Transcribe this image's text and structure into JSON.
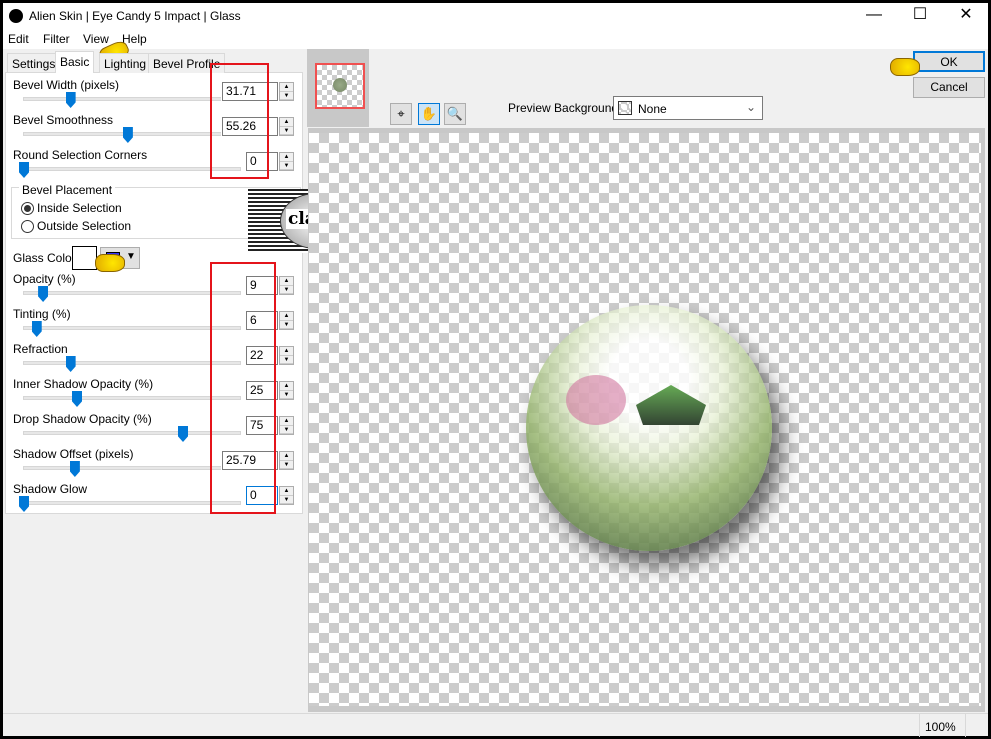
{
  "window": {
    "title": "Alien Skin | Eye Candy 5 Impact | Glass",
    "minimize": "—",
    "maximize": "☐",
    "close": "✕"
  },
  "menu": [
    "Edit",
    "Filter",
    "View",
    "Help"
  ],
  "tabs": [
    "Settings",
    "Basic",
    "Lighting",
    "Bevel Profile"
  ],
  "active_tab": "Basic",
  "controls": [
    {
      "label": "Bevel Width (pixels)",
      "value": "31.71",
      "slider_percent": 22
    },
    {
      "label": "Bevel Smoothness",
      "value": "55.26",
      "slider_percent": 49
    },
    {
      "label": "Round Selection Corners",
      "value": "0",
      "slider_percent": 0
    }
  ],
  "bevel_placement": {
    "title": "Bevel Placement",
    "options": [
      "Inside Selection",
      "Outside Selection"
    ],
    "selected": "Inside Selection"
  },
  "glass_color": {
    "label": "Glass Color",
    "color": "#ffffff"
  },
  "controls2": [
    {
      "label": "Opacity (%)",
      "value": "9",
      "slider_percent": 9
    },
    {
      "label": "Tinting (%)",
      "value": "6",
      "slider_percent": 6
    },
    {
      "label": "Refraction",
      "value": "22",
      "slider_percent": 22
    },
    {
      "label": "Inner Shadow Opacity (%)",
      "value": "25",
      "slider_percent": 25
    },
    {
      "label": "Drop Shadow Opacity (%)",
      "value": "75",
      "slider_percent": 75
    },
    {
      "label": "Shadow Offset (pixels)",
      "value": "25.79",
      "slider_percent": 24
    },
    {
      "label": "Shadow Glow",
      "value": "0",
      "slider_percent": 0
    }
  ],
  "logo_text": "claudia",
  "buttons": {
    "ok": "OK",
    "cancel": "Cancel"
  },
  "preview": {
    "background_label": "Preview Background:",
    "background_value": "None"
  },
  "tools": [
    "navigate-icon",
    "hand-icon",
    "zoom-icon"
  ],
  "status": {
    "zoom": "100%"
  },
  "colors": {
    "accent": "#0078d7",
    "highlight": "#e4141b"
  }
}
